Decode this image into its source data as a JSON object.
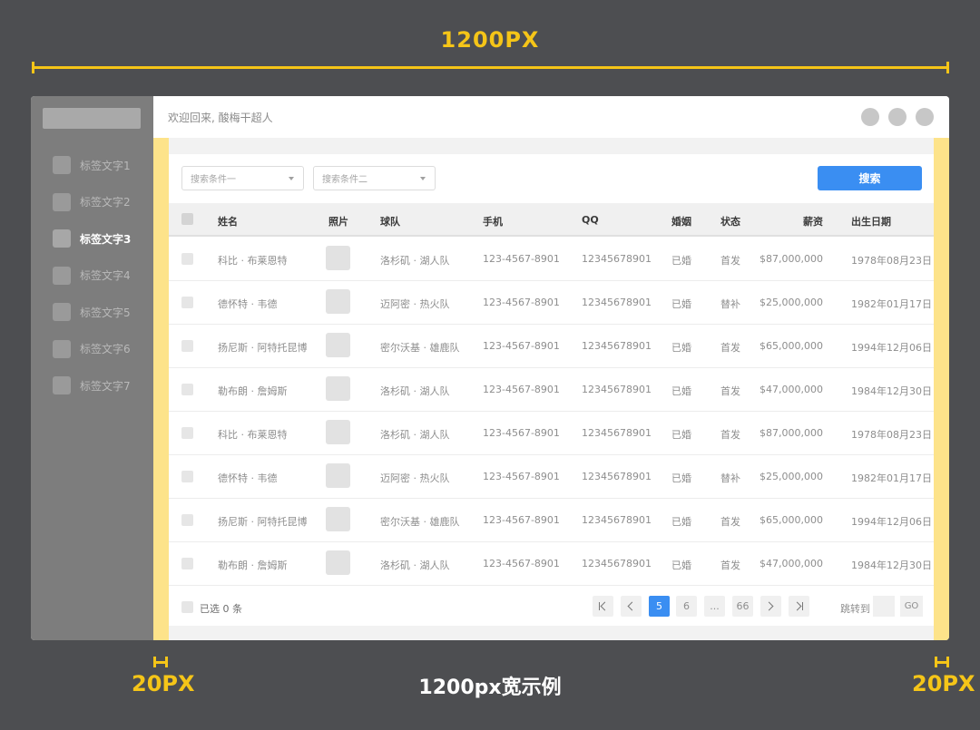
{
  "annotations": {
    "top_width": "1200PX",
    "bottom_caption": "1200px宽示例",
    "left_margin": "20PX",
    "right_margin": "20PX"
  },
  "sidebar": {
    "items": [
      {
        "label": "标签文字1",
        "active": false
      },
      {
        "label": "标签文字2",
        "active": false
      },
      {
        "label": "标签文字3",
        "active": true
      },
      {
        "label": "标签文字4",
        "active": false
      },
      {
        "label": "标签文字5",
        "active": false
      },
      {
        "label": "标签文字6",
        "active": false
      },
      {
        "label": "标签文字7",
        "active": false
      }
    ]
  },
  "header": {
    "welcome": "欢迎回来, 酸梅干超人"
  },
  "filters": {
    "filter1_placeholder": "搜索条件一",
    "filter2_placeholder": "搜索条件二",
    "search_label": "搜索"
  },
  "table": {
    "columns": [
      "姓名",
      "照片",
      "球队",
      "手机",
      "QQ",
      "婚姻",
      "状态",
      "薪资",
      "出生日期"
    ],
    "rows": [
      {
        "name": "科比 · 布莱恩特",
        "team": "洛杉矶 · 湖人队",
        "phone": "123-4567-8901",
        "qq": "12345678901",
        "marriage": "已婚",
        "status": "首发",
        "salary": "$87,000,000",
        "birth": "1978年08月23日"
      },
      {
        "name": "德怀特 · 韦德",
        "team": "迈阿密 · 热火队",
        "phone": "123-4567-8901",
        "qq": "12345678901",
        "marriage": "已婚",
        "status": "替补",
        "salary": "$25,000,000",
        "birth": "1982年01月17日"
      },
      {
        "name": "扬尼斯 · 阿特托昆博",
        "team": "密尔沃基 · 雄鹿队",
        "phone": "123-4567-8901",
        "qq": "12345678901",
        "marriage": "已婚",
        "status": "首发",
        "salary": "$65,000,000",
        "birth": "1994年12月06日"
      },
      {
        "name": "勒布朗 · 詹姆斯",
        "team": "洛杉矶 · 湖人队",
        "phone": "123-4567-8901",
        "qq": "12345678901",
        "marriage": "已婚",
        "status": "首发",
        "salary": "$47,000,000",
        "birth": "1984年12月30日"
      },
      {
        "name": "科比 · 布莱恩特",
        "team": "洛杉矶 · 湖人队",
        "phone": "123-4567-8901",
        "qq": "12345678901",
        "marriage": "已婚",
        "status": "首发",
        "salary": "$87,000,000",
        "birth": "1978年08月23日"
      },
      {
        "name": "德怀特 · 韦德",
        "team": "迈阿密 · 热火队",
        "phone": "123-4567-8901",
        "qq": "12345678901",
        "marriage": "已婚",
        "status": "替补",
        "salary": "$25,000,000",
        "birth": "1982年01月17日"
      },
      {
        "name": "扬尼斯 · 阿特托昆博",
        "team": "密尔沃基 · 雄鹿队",
        "phone": "123-4567-8901",
        "qq": "12345678901",
        "marriage": "已婚",
        "status": "首发",
        "salary": "$65,000,000",
        "birth": "1994年12月06日"
      },
      {
        "name": "勒布朗 · 詹姆斯",
        "team": "洛杉矶 · 湖人队",
        "phone": "123-4567-8901",
        "qq": "12345678901",
        "marriage": "已婚",
        "status": "首发",
        "salary": "$47,000,000",
        "birth": "1984年12月30日"
      }
    ]
  },
  "footer": {
    "selected": "已选 0 条",
    "pages": {
      "current": "5",
      "next": "6",
      "ellipsis": "...",
      "last": "66"
    },
    "jump_label": "跳转到",
    "go_label": "GO"
  },
  "colors": {
    "accent": "#3a8ef2",
    "annotation": "#f5c518",
    "margin_highlight": "#fde38a"
  }
}
